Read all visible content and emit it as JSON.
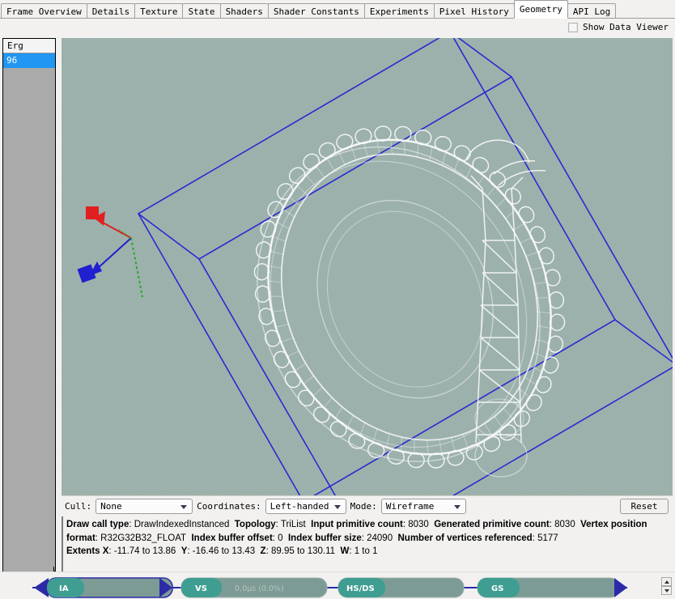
{
  "tabs": [
    {
      "label": "Frame Overview",
      "active": false
    },
    {
      "label": "Details",
      "active": false
    },
    {
      "label": "Texture",
      "active": false
    },
    {
      "label": "State",
      "active": false
    },
    {
      "label": "Shaders",
      "active": false
    },
    {
      "label": "Shader Constants",
      "active": false
    },
    {
      "label": "Experiments",
      "active": false
    },
    {
      "label": "Pixel History",
      "active": false
    },
    {
      "label": "Geometry",
      "active": true
    },
    {
      "label": "API Log",
      "active": false
    }
  ],
  "toolbar": {
    "show_data_viewer_label": "Show Data Viewer",
    "show_data_viewer_checked": false
  },
  "sidebar": {
    "header": "Erg",
    "rows": [
      {
        "label": "96",
        "selected": true
      }
    ]
  },
  "viewport": {
    "background_color": "#9cb1ac",
    "bbox_color": "#2a2ad0",
    "mesh_color": "#ffffff",
    "axis_x_color": "#e02020",
    "axis_y_color": "#22aa22",
    "axis_z_color": "#2020d0"
  },
  "controls": {
    "cull_label": "Cull:",
    "cull_value": "None",
    "coordinates_label": "Coordinates:",
    "coordinates_value": "Left-handed",
    "mode_label": "Mode:",
    "mode_value": "Wireframe",
    "reset_label": "Reset"
  },
  "info": {
    "draw_call_type_label": "Draw call type",
    "draw_call_type_value": "DrawIndexedInstanced",
    "topology_label": "Topology",
    "topology_value": "TriList",
    "input_primitive_count_label": "Input primitive count",
    "input_primitive_count_value": "8030",
    "generated_primitive_count_label": "Generated primitive count",
    "generated_primitive_count_value": "8030",
    "vertex_position_format_label": "Vertex position format",
    "vertex_position_format_value": "R32G32B32_FLOAT",
    "index_buffer_offset_label": "Index buffer offset",
    "index_buffer_offset_value": "0",
    "index_buffer_size_label": "Index buffer size",
    "index_buffer_size_value": "24090",
    "number_of_vertices_referenced_label": "Number of vertices referenced",
    "number_of_vertices_referenced_value": "5177",
    "extents_label": "Extents",
    "extents_x_label": "X",
    "extents_x_value": "-11.74 to 13.86",
    "extents_y_label": "Y",
    "extents_y_value": "-16.46 to 13.43",
    "extents_z_label": "Z",
    "extents_z_value": "89.95 to 130.11",
    "extents_w_label": "W",
    "extents_w_value": "1 to 1"
  },
  "pipeline": {
    "stages": [
      {
        "name": "IA",
        "timing": ""
      },
      {
        "name": "VS",
        "timing": "0.0µs  (0.0%)"
      },
      {
        "name": "HS/DS",
        "timing": ""
      },
      {
        "name": "GS",
        "timing": ""
      }
    ],
    "accent_color": "#2b2ba8",
    "stage_color": "#3f9e91"
  }
}
